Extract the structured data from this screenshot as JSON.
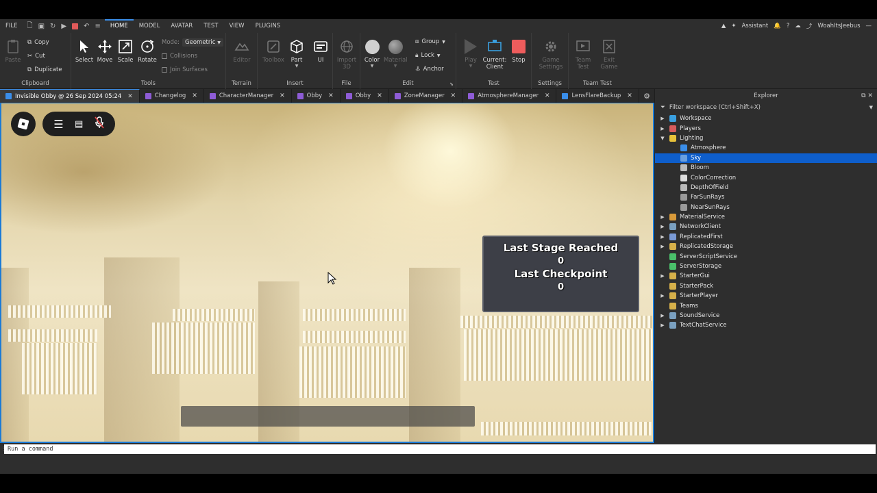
{
  "menu": {
    "file": "FILE",
    "tabs": [
      "HOME",
      "MODEL",
      "AVATAR",
      "TEST",
      "VIEW",
      "PLUGINS"
    ],
    "active_tab": "HOME",
    "assistant": "Assistant",
    "username": "WoahItsJeebus"
  },
  "ribbon": {
    "clipboard": {
      "label": "Clipboard",
      "paste": "Paste",
      "copy": "Copy",
      "cut": "Cut",
      "duplicate": "Duplicate"
    },
    "tools": {
      "label": "Tools",
      "select": "Select",
      "move": "Move",
      "scale": "Scale",
      "rotate": "Rotate",
      "mode_label": "Mode:",
      "mode_value": "Geometric",
      "collisions": "Collisions",
      "join_surfaces": "Join Surfaces"
    },
    "terrain": {
      "label": "Terrain",
      "editor": "Editor"
    },
    "insert": {
      "label": "Insert",
      "toolbox": "Toolbox",
      "part": "Part",
      "ui": "UI"
    },
    "file": {
      "label": "File",
      "import": "Import\n3D"
    },
    "edit": {
      "label": "Edit",
      "color": "Color",
      "material": "Material",
      "group": "Group",
      "lock": "Lock",
      "anchor": "Anchor"
    },
    "test": {
      "label": "Test",
      "play": "Play",
      "current_client": "Current:\nClient",
      "stop": "Stop"
    },
    "settings": {
      "label": "Settings",
      "game_settings": "Game\nSettings"
    },
    "team_test": {
      "label": "Team Test",
      "team_test": "Team\nTest",
      "exit_game": "Exit\nGame"
    }
  },
  "doc_tabs": [
    {
      "label": "Invisible Obby @ 26 Sep 2024 05:24",
      "color": "#3a8eea",
      "active": true
    },
    {
      "label": "Changelog",
      "color": "#8e5cd6"
    },
    {
      "label": "CharacterManager",
      "color": "#8e5cd6"
    },
    {
      "label": "Obby",
      "color": "#8e5cd6"
    },
    {
      "label": "Obby",
      "color": "#8e5cd6"
    },
    {
      "label": "ZoneManager",
      "color": "#8e5cd6"
    },
    {
      "label": "AtmosphereManager",
      "color": "#8e5cd6"
    },
    {
      "label": "LensFlareBackup",
      "color": "#3a8eea"
    }
  ],
  "game_ui": {
    "last_stage_label": "Last Stage Reached",
    "last_stage_value": "0",
    "last_checkpoint_label": "Last Checkpoint",
    "last_checkpoint_value": "0"
  },
  "explorer": {
    "title": "Explorer",
    "filter": "Filter workspace (Ctrl+Shift+X)",
    "items": [
      {
        "label": "Workspace",
        "depth": 0,
        "arrow": "▶",
        "color": "#3aa0e0"
      },
      {
        "label": "Players",
        "depth": 0,
        "arrow": "▶",
        "color": "#d65c5c"
      },
      {
        "label": "Lighting",
        "depth": 0,
        "arrow": "▼",
        "color": "#e8c23a"
      },
      {
        "label": "Atmosphere",
        "depth": 1,
        "arrow": "",
        "color": "#3a8eea"
      },
      {
        "label": "Sky",
        "depth": 1,
        "arrow": "",
        "color": "#6aa0e0",
        "selected": true
      },
      {
        "label": "Bloom",
        "depth": 1,
        "arrow": "",
        "color": "#bbbbbb"
      },
      {
        "label": "ColorCorrection",
        "depth": 1,
        "arrow": "",
        "color": "#dddddd"
      },
      {
        "label": "DepthOfField",
        "depth": 1,
        "arrow": "",
        "color": "#bbbbbb"
      },
      {
        "label": "FarSunRays",
        "depth": 1,
        "arrow": "",
        "color": "#999999"
      },
      {
        "label": "NearSunRays",
        "depth": 1,
        "arrow": "",
        "color": "#999999"
      },
      {
        "label": "MaterialService",
        "depth": 0,
        "arrow": "▶",
        "color": "#d89a3a"
      },
      {
        "label": "NetworkClient",
        "depth": 0,
        "arrow": "▶",
        "color": "#7aa0c0"
      },
      {
        "label": "ReplicatedFirst",
        "depth": 0,
        "arrow": "▶",
        "color": "#7a9ad6"
      },
      {
        "label": "ReplicatedStorage",
        "depth": 0,
        "arrow": "▶",
        "color": "#d6b04a"
      },
      {
        "label": "ServerScriptService",
        "depth": 0,
        "arrow": "",
        "color": "#4ac06a"
      },
      {
        "label": "ServerStorage",
        "depth": 0,
        "arrow": "",
        "color": "#4ac06a"
      },
      {
        "label": "StarterGui",
        "depth": 0,
        "arrow": "▶",
        "color": "#d6b04a"
      },
      {
        "label": "StarterPack",
        "depth": 0,
        "arrow": "",
        "color": "#d6b04a"
      },
      {
        "label": "StarterPlayer",
        "depth": 0,
        "arrow": "▶",
        "color": "#d6b04a"
      },
      {
        "label": "Teams",
        "depth": 0,
        "arrow": "",
        "color": "#d6b04a"
      },
      {
        "label": "SoundService",
        "depth": 0,
        "arrow": "▶",
        "color": "#7aa0c0"
      },
      {
        "label": "TextChatService",
        "depth": 0,
        "arrow": "▶",
        "color": "#7aa0c0"
      }
    ]
  },
  "command_bar": {
    "placeholder": "Run a command"
  },
  "colors": {
    "accent": "#1a7ad6",
    "selected": "#0e5ecb",
    "stop": "#ee5c5c"
  }
}
